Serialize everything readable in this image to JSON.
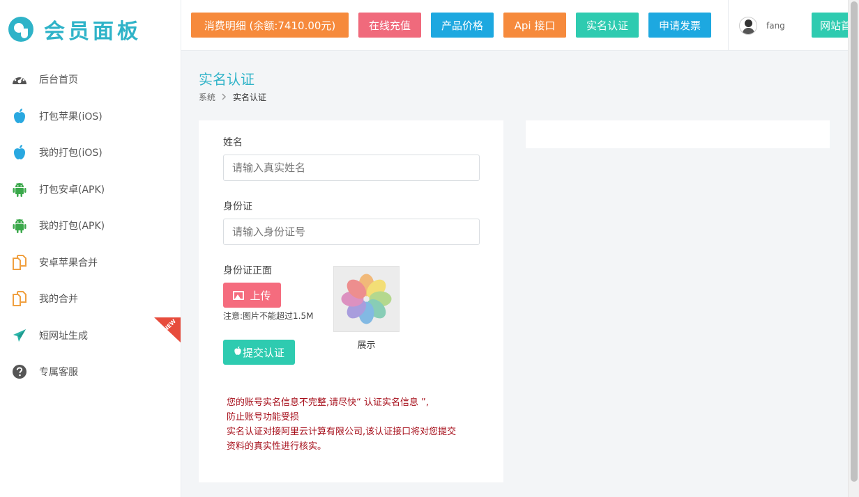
{
  "logo": {
    "text": "会员面板"
  },
  "sidebar": {
    "items": [
      {
        "label": "后台首页",
        "icon": "dashboard-icon"
      },
      {
        "label": "打包苹果(iOS)",
        "icon": "apple-icon"
      },
      {
        "label": "我的打包(iOS)",
        "icon": "apple-icon"
      },
      {
        "label": "打包安卓(APK)",
        "icon": "android-icon"
      },
      {
        "label": "我的打包(APK)",
        "icon": "android-icon"
      },
      {
        "label": "安卓苹果合并",
        "icon": "copy-icon"
      },
      {
        "label": "我的合并",
        "icon": "copy-icon"
      },
      {
        "label": "短网址生成",
        "icon": "plane-icon",
        "badge": "NEW"
      },
      {
        "label": "专属客服",
        "icon": "question-icon"
      }
    ]
  },
  "topbar": {
    "buttons": [
      {
        "label": "消费明细 (余额:7410.00元)",
        "color": "#f68a3c"
      },
      {
        "label": "在线充值",
        "color": "#f06a7c"
      },
      {
        "label": "产品价格",
        "color": "#1da8e0"
      },
      {
        "label": "Api 接口",
        "color": "#f68a3c"
      },
      {
        "label": "实名认证",
        "color": "#2ecbb0"
      },
      {
        "label": "申请发票",
        "color": "#1da8e0"
      },
      {
        "label": "网站首",
        "color": "#2ecbb0"
      }
    ],
    "user": {
      "name": "fang"
    }
  },
  "page": {
    "title": "实名认证",
    "breadcrumb": {
      "root": "系统",
      "current": "实名认证"
    }
  },
  "form": {
    "name_label": "姓名",
    "name_placeholder": "请输入真实姓名",
    "id_label": "身份证",
    "id_placeholder": "请输入身份证号",
    "id_front_label": "身份证正面",
    "upload_label": "上传",
    "note": "注意:图片不能超过1.5M",
    "preview_label": "展示",
    "submit_label": "提交认证",
    "warning_lines": [
      "您的账号实名信息不完整,请尽快“ 认证实名信息 ”,",
      "防止账号功能受损",
      "实名认证对接阿里云计算有限公司,该认证接口将对您提交",
      "资料的真实性进行核实。"
    ]
  },
  "colors": {
    "accent": "#2fb3c8",
    "warning_text": "#a60e1a"
  }
}
